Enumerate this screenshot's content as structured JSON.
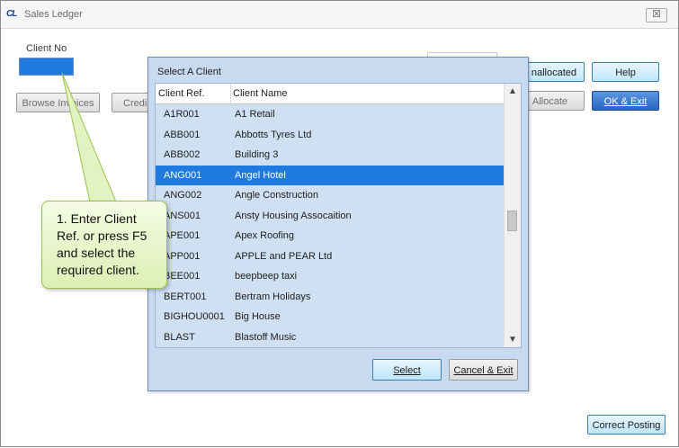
{
  "window": {
    "title": "Sales Ledger",
    "logo": "CL",
    "close_glyph": "☒"
  },
  "form": {
    "client_no_label": "Client No",
    "client_no_value": ""
  },
  "toolbar": {
    "browse_invoices": "Browse Invoices",
    "credit_partial": "Credi",
    "unallocated_partial": "nallocated",
    "help": "Help",
    "allocate": "Allocate",
    "ok_exit": "OK & Exit",
    "correct_posting": "Correct Posting"
  },
  "dialog": {
    "title": "Select A Client",
    "columns": [
      "Client Ref.",
      "Client Name"
    ],
    "rows": [
      {
        "ref": "A1R001",
        "name": "A1 Retail"
      },
      {
        "ref": "ABB001",
        "name": "Abbotts Tyres Ltd"
      },
      {
        "ref": "ABB002",
        "name": "Building 3"
      },
      {
        "ref": "ANG001",
        "name": "Angel Hotel"
      },
      {
        "ref": "ANG002",
        "name": "Angle Construction"
      },
      {
        "ref": "ANS001",
        "name": "Ansty Housing Assocaition"
      },
      {
        "ref": "APE001",
        "name": "Apex Roofing"
      },
      {
        "ref": "APP001",
        "name": "APPLE and PEAR Ltd"
      },
      {
        "ref": "BEE001",
        "name": "beepbeep taxi"
      },
      {
        "ref": "BERT001",
        "name": "Bertram Holidays"
      },
      {
        "ref": "BIGHOU0001",
        "name": "Big House"
      },
      {
        "ref": "BLAST",
        "name": "Blastoff Music"
      }
    ],
    "selected_ref": "ANG001",
    "select_button": "Select",
    "cancel_button": "Cancel & Exit"
  },
  "callout": {
    "text": "1. Enter Client Ref. or press F5 and select the required client."
  },
  "colors": {
    "accent": "#1f7ae0",
    "callout": "#dcefb3"
  }
}
